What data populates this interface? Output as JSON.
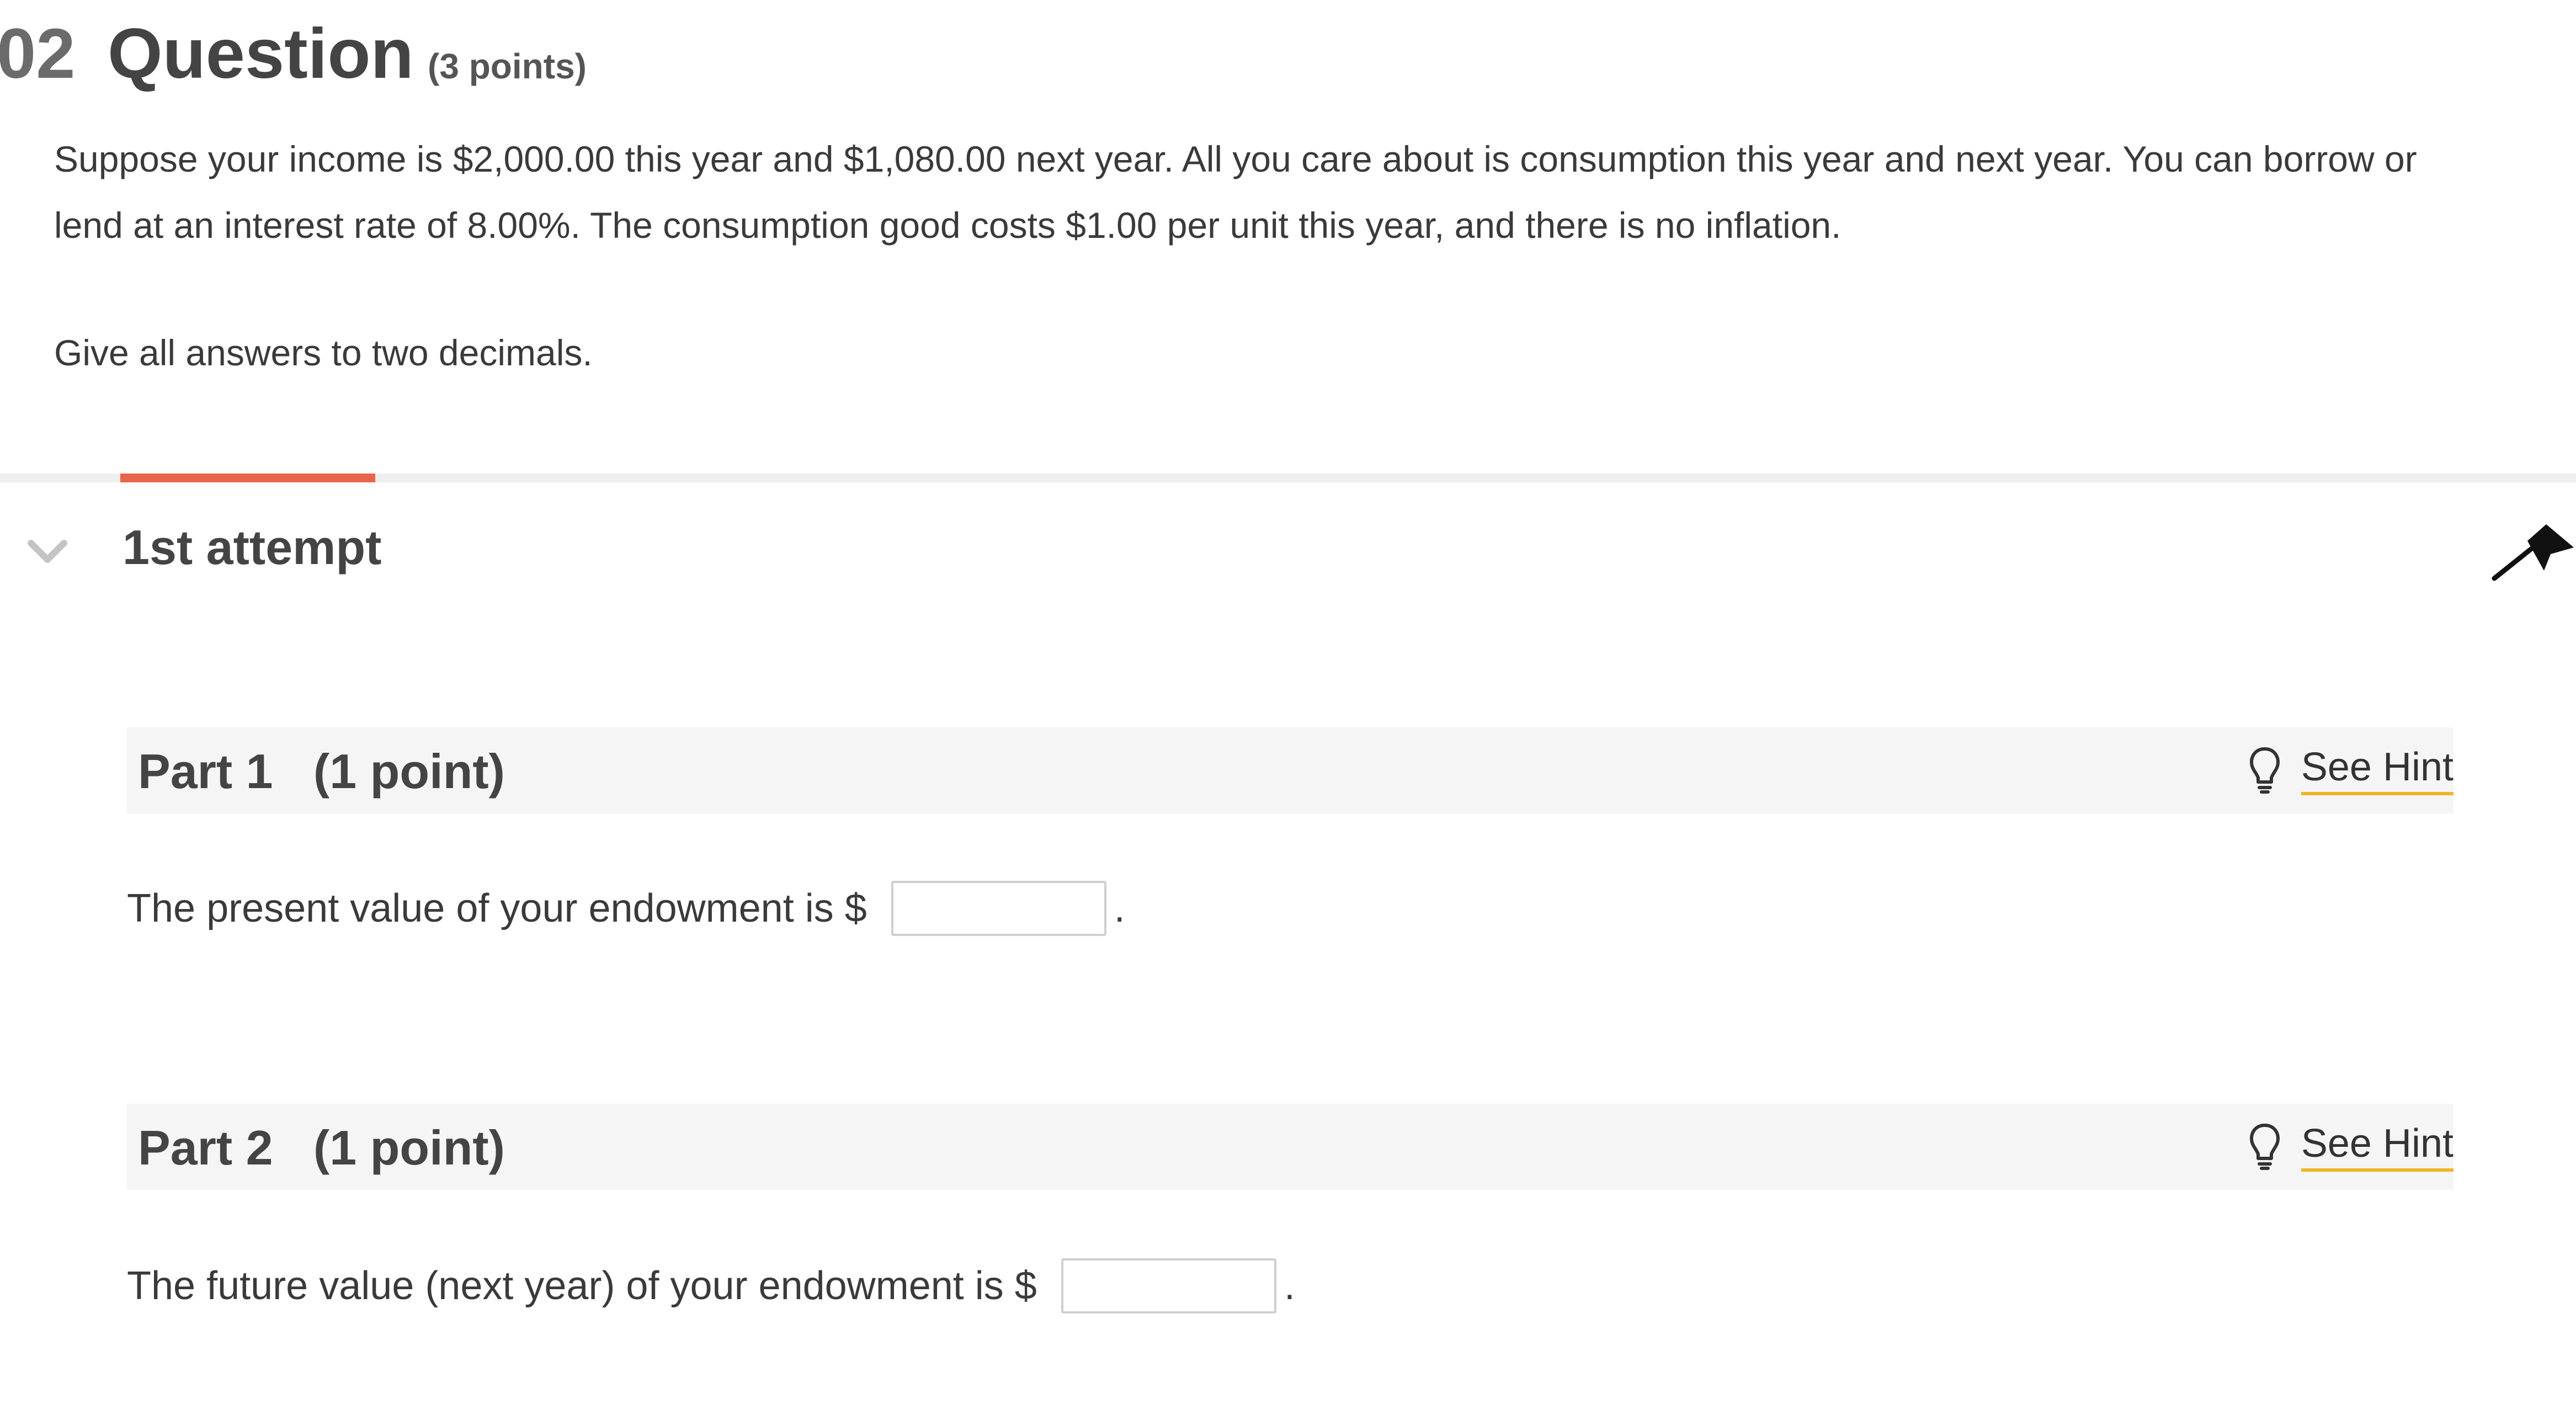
{
  "question": {
    "number": "02",
    "title": "Question",
    "points": "(3 points)",
    "text": "Suppose your income is $2,000.00 this year and $1,080.00 next year. All you care about is consumption this year and next year. You can borrow or lend at an interest rate of 8.00%. The consumption good costs $1.00 per unit this year, and there is no inflation.",
    "instruction": "Give all answers to two decimals."
  },
  "attempt": {
    "label": "1st attempt",
    "progress_fraction": 0.033
  },
  "parts": [
    {
      "title": "Part 1   (1 point)",
      "hint_label": "See Hint",
      "prompt": "The present value of your endowment is $",
      "value": "",
      "suffix": "."
    },
    {
      "title": "Part 2   (1 point)",
      "hint_label": "See Hint",
      "prompt": "The future value (next year) of your endowment is $",
      "value": "",
      "suffix": "."
    }
  ],
  "icons": {
    "collapse": "chevron-down-icon",
    "flag": "flag-icon",
    "hint": "lightbulb-icon"
  },
  "colors": {
    "progress_accent": "#e8654a",
    "hint_underline": "#f0b429",
    "part_header_bg": "#f5f5f5"
  }
}
